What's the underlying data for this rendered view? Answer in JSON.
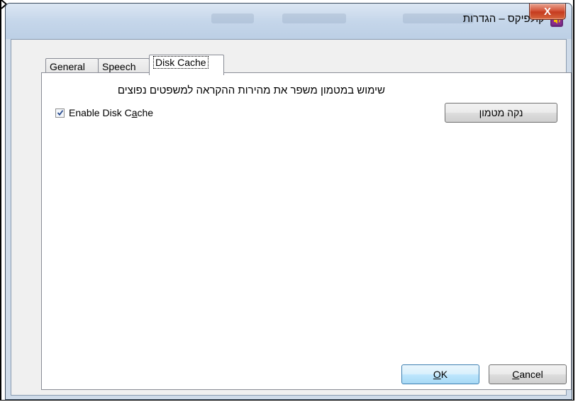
{
  "window": {
    "title": "קולפיקס – הגדרות",
    "close_glyph": "X"
  },
  "tabs": [
    {
      "label": "General"
    },
    {
      "label": "Speech"
    },
    {
      "label": "Disk Cache"
    }
  ],
  "disk_cache": {
    "description": "שימוש במטמון משפר את מהירות ההקראה למשפטים נפוצים",
    "enable_checkbox": {
      "label_prefix": "Enable Disk C",
      "label_mnemonic": "a",
      "label_suffix": "che",
      "checked": true
    },
    "clear_cache_button": "נקה מטמון"
  },
  "footer": {
    "ok": {
      "mnemonic": "O",
      "rest": "K"
    },
    "cancel": {
      "mnemonic": "C",
      "rest": "ancel"
    }
  },
  "colors": {
    "accent": "#3c7fb1",
    "title_icon": "#6a2a7a",
    "close_button": "#c53b1f"
  }
}
